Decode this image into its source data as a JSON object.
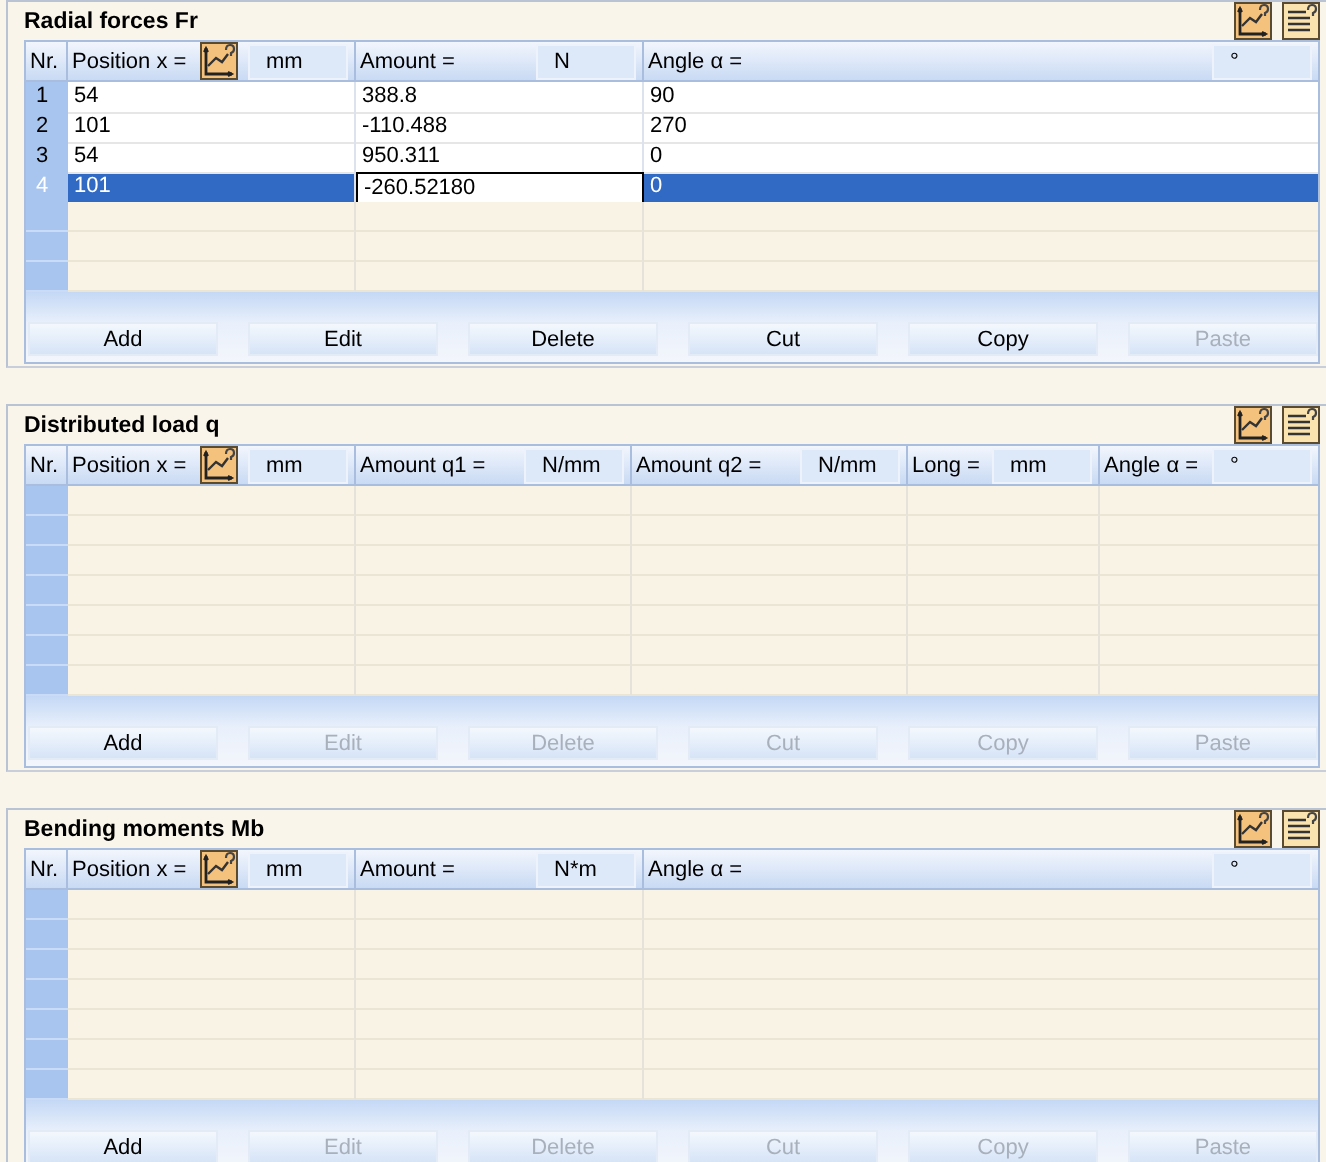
{
  "sections": [
    {
      "title": "Radial forces Fr",
      "nr_label": "Nr.",
      "columns": [
        {
          "label": "Position x =",
          "unit": "mm",
          "picker": true
        },
        {
          "label": "Amount =",
          "unit": "N",
          "picker": false
        },
        {
          "label": "Angle α =",
          "unit": "°",
          "picker": false
        }
      ],
      "rows": [
        {
          "nr": "1",
          "selected": false,
          "cells": [
            {
              "text": "54",
              "editing": false
            },
            {
              "text": "388.8",
              "editing": false
            },
            {
              "text": "90",
              "editing": false
            }
          ]
        },
        {
          "nr": "2",
          "selected": false,
          "cells": [
            {
              "text": "101",
              "editing": false
            },
            {
              "text": "-110.488",
              "editing": false
            },
            {
              "text": "270",
              "editing": false
            }
          ]
        },
        {
          "nr": "3",
          "selected": false,
          "cells": [
            {
              "text": "54",
              "editing": false
            },
            {
              "text": "950.311",
              "editing": false
            },
            {
              "text": "0",
              "editing": false
            }
          ]
        },
        {
          "nr": "4",
          "selected": true,
          "cells": [
            {
              "text": "101",
              "editing": false
            },
            {
              "text": "-260.52180",
              "editing": true
            },
            {
              "text": "0",
              "editing": false
            }
          ]
        }
      ],
      "buttons": [
        {
          "label": "Add",
          "disabled": false
        },
        {
          "label": "Edit",
          "disabled": false
        },
        {
          "label": "Delete",
          "disabled": false
        },
        {
          "label": "Cut",
          "disabled": false
        },
        {
          "label": "Copy",
          "disabled": false
        },
        {
          "label": "Paste",
          "disabled": true
        }
      ]
    },
    {
      "title": "Distributed load q",
      "nr_label": "Nr.",
      "columns": [
        {
          "label": "Position x =",
          "unit": "mm",
          "picker": true
        },
        {
          "label": "Amount q1 =",
          "unit": "N/mm",
          "picker": false
        },
        {
          "label": "Amount q2 =",
          "unit": "N/mm",
          "picker": false
        },
        {
          "label": "Long =",
          "unit": "mm",
          "picker": false
        },
        {
          "label": "Angle α =",
          "unit": "°",
          "picker": false
        }
      ],
      "buttons": [
        {
          "label": "Add",
          "disabled": false
        },
        {
          "label": "Edit",
          "disabled": true
        },
        {
          "label": "Delete",
          "disabled": true
        },
        {
          "label": "Cut",
          "disabled": true
        },
        {
          "label": "Copy",
          "disabled": true
        },
        {
          "label": "Paste",
          "disabled": true
        }
      ]
    },
    {
      "title": "Bending moments Mb",
      "nr_label": "Nr.",
      "columns": [
        {
          "label": "Position x =",
          "unit": "mm",
          "picker": true
        },
        {
          "label": "Amount =",
          "unit": "N*m",
          "picker": false
        },
        {
          "label": "Angle α =",
          "unit": "°",
          "picker": false
        }
      ],
      "buttons": [
        {
          "label": "Add",
          "disabled": false
        },
        {
          "label": "Edit",
          "disabled": true
        },
        {
          "label": "Delete",
          "disabled": true
        },
        {
          "label": "Cut",
          "disabled": true
        },
        {
          "label": "Copy",
          "disabled": true
        },
        {
          "label": "Paste",
          "disabled": true
        }
      ]
    }
  ]
}
